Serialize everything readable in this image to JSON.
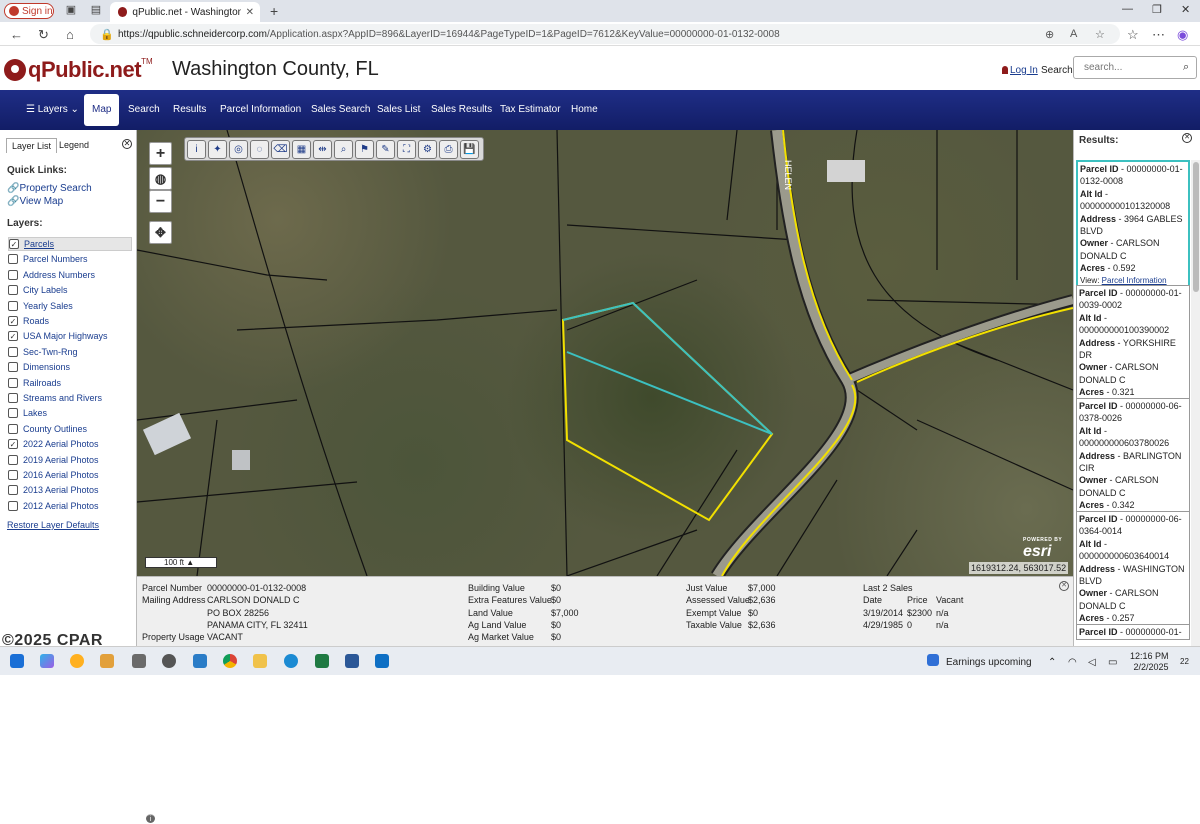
{
  "browser": {
    "signin_label": "Sign in",
    "tab_title": "qPublic.net - Washington County",
    "url_host": "https://qpublic.schneidercorp.com",
    "url_path": "/Application.aspx?AppID=896&LayerID=16944&PageTypeID=1&PageID=7612&KeyValue=00000000-01-0132-0008"
  },
  "header": {
    "brand": "qPublic.net",
    "tm": "TM",
    "county": "Washington County, FL",
    "login": "Log In",
    "search_label": "Search",
    "search_placeholder": "search..."
  },
  "nav": {
    "items": [
      "Layers",
      "Map",
      "Search",
      "Results",
      "Parcel Information",
      "Sales Search",
      "Sales List",
      "Sales Results",
      "Tax Estimator",
      "Home"
    ],
    "active": "Map"
  },
  "left_panel": {
    "tab_layer_list": "Layer List",
    "tab_legend": "Legend",
    "quick_links_title": "Quick Links:",
    "quick_links": [
      "Property Search",
      "View Map"
    ],
    "layers_title": "Layers:",
    "layers": [
      {
        "label": "Parcels",
        "checked": true
      },
      {
        "label": "Parcel Numbers",
        "checked": false
      },
      {
        "label": "Address Numbers",
        "checked": false
      },
      {
        "label": "City Labels",
        "checked": false
      },
      {
        "label": "Yearly Sales",
        "checked": false
      },
      {
        "label": "Roads",
        "checked": true
      },
      {
        "label": "USA Major Highways",
        "checked": true
      },
      {
        "label": "Sec-Twn-Rng",
        "checked": false
      },
      {
        "label": "Dimensions",
        "checked": false
      },
      {
        "label": "Railroads",
        "checked": false
      },
      {
        "label": "Streams and Rivers",
        "checked": false
      },
      {
        "label": "Lakes",
        "checked": false
      },
      {
        "label": "County Outlines",
        "checked": false
      },
      {
        "label": "2022 Aerial Photos",
        "checked": true
      },
      {
        "label": "2019 Aerial Photos",
        "checked": false
      },
      {
        "label": "2016 Aerial Photos",
        "checked": false
      },
      {
        "label": "2013 Aerial Photos",
        "checked": false
      },
      {
        "label": "2012 Aerial Photos",
        "checked": false
      }
    ],
    "restore_link": "Restore Layer Defaults"
  },
  "map": {
    "scale_label": "100 ft",
    "coordinates": "1619312.24, 563017.52",
    "esri_powered": "POWERED BY",
    "esri_logo": "esri",
    "road_label": "HELEN"
  },
  "parcel_info": {
    "parcel_number_label": "Parcel Number",
    "parcel_number": "00000000-01-0132-0008",
    "mailing_address_label": "Mailing Address",
    "mailing_address_lines": [
      "CARLSON DONALD C",
      "PO BOX 28256",
      "PANAMA CITY, FL 32411"
    ],
    "property_usage_label": "Property Usage",
    "property_usage": "VACANT",
    "values_col1": [
      {
        "label": "Building Value",
        "value": "$0"
      },
      {
        "label": "Extra Features Value",
        "value": "$0"
      },
      {
        "label": "Land Value",
        "value": "$7,000"
      },
      {
        "label": "Ag Land Value",
        "value": "$0"
      },
      {
        "label": "Ag Market Value",
        "value": "$0"
      }
    ],
    "values_col2": [
      {
        "label": "Just Value",
        "value": "$7,000"
      },
      {
        "label": "Assessed Value",
        "value": "$2,636"
      },
      {
        "label": "Exempt Value",
        "value": "$0"
      },
      {
        "label": "Taxable Value",
        "value": "$2,636"
      }
    ],
    "sales_title": "Last 2 Sales",
    "sales_headers": [
      "Date",
      "Price",
      "Vacant"
    ],
    "sales": [
      {
        "date": "3/19/2014",
        "price": "$2300",
        "vacant": "n/a"
      },
      {
        "date": "4/29/1985",
        "price": "0",
        "vacant": "n/a"
      }
    ]
  },
  "results": {
    "title": "Results:",
    "view_label": "View:",
    "view_link": "Parcel Information",
    "cards": [
      {
        "parcel_label": "Parcel ID",
        "parcel_id": "00000000-01-0132-0008",
        "alt_label": "Alt Id",
        "alt_id": "000000000101320008",
        "address_label": "Address",
        "address": "3964 GABLES BLVD",
        "owner_label": "Owner",
        "owner": "CARLSON DONALD C",
        "acres_label": "Acres",
        "acres": "0.592"
      },
      {
        "parcel_label": "Parcel ID",
        "parcel_id": "00000000-01-0039-0002",
        "alt_label": "Alt Id",
        "alt_id": "000000000100390002",
        "address_label": "Address",
        "address": "YORKSHIRE DR",
        "owner_label": "Owner",
        "owner": "CARLSON DONALD C",
        "acres_label": "Acres",
        "acres": "0.321"
      },
      {
        "parcel_label": "Parcel ID",
        "parcel_id": "00000000-06-0378-0026",
        "alt_label": "Alt Id",
        "alt_id": "000000000603780026",
        "address_label": "Address",
        "address": "BARLINGTON CIR",
        "owner_label": "Owner",
        "owner": "CARLSON DONALD C",
        "acres_label": "Acres",
        "acres": "0.342"
      },
      {
        "parcel_label": "Parcel ID",
        "parcel_id": "00000000-06-0364-0014",
        "alt_label": "Alt Id",
        "alt_id": "000000000603640014",
        "address_label": "Address",
        "address": "WASHINGTON BLVD",
        "owner_label": "Owner",
        "owner": "CARLSON DONALD C",
        "acres_label": "Acres",
        "acres": "0.257"
      },
      {
        "parcel_label": "Parcel ID",
        "parcel_id": "00000000-01-"
      }
    ]
  },
  "taskbar": {
    "news_label": "Earnings upcoming",
    "time": "12:16 PM",
    "date": "2/2/2025",
    "notification_count": "22"
  },
  "watermark": "©2025 CPAR",
  "colors": {
    "brand_red": "#8e1b1b",
    "nav_blue": "#1f2e86",
    "selected_parcel": "#3cc0c0",
    "road_yellow": "#f2e000",
    "link_blue": "#1a3d8f"
  }
}
